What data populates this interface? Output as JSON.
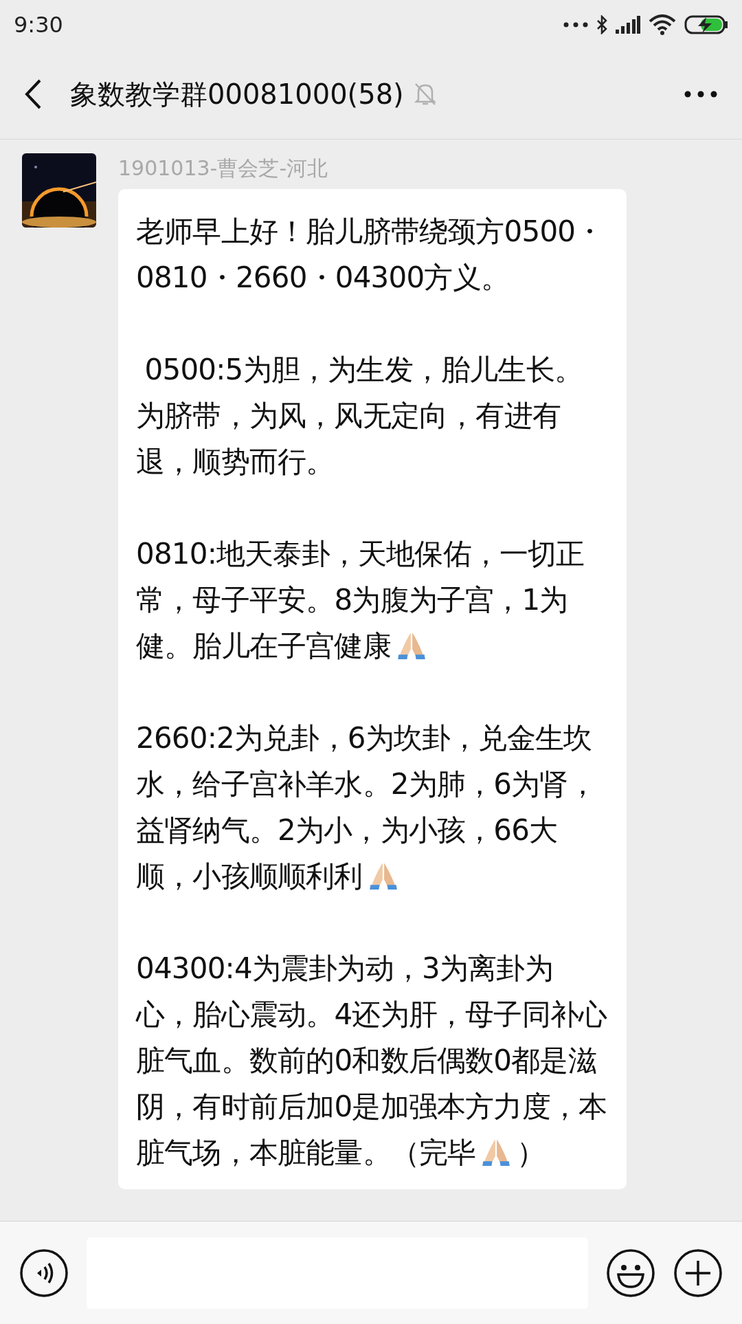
{
  "status_bar": {
    "time": "9:30"
  },
  "header": {
    "title": "象数教学群00081000(58)",
    "muted": true
  },
  "messages": [
    {
      "sender": "1901013-曹会芝-河北",
      "paragraphs": [
        [
          {
            "kind": "text",
            "text": "老师早上好！胎儿脐带绕颈方0500・0810・2660・04300方义。"
          }
        ],
        [
          {
            "kind": "text",
            "text": " 0500:5为胆，为生发，胎儿生长。为脐带，为风，风无定向，有进有退，顺势而行。"
          }
        ],
        [
          {
            "kind": "text",
            "text": "0810:地天泰卦，天地保佑，一切正常，母子平安。8为腹为子宫，1为健。胎儿在子宫健康"
          },
          {
            "kind": "praying-hands"
          }
        ],
        [
          {
            "kind": "text",
            "text": "2660:2为兑卦，6为坎卦，兑金生坎水，给子宫补羊水。2为肺，6为肾，益肾纳气。2为小，为小孩，66大顺，小孩顺顺利利"
          },
          {
            "kind": "praying-hands"
          }
        ],
        [
          {
            "kind": "text",
            "text": "04300:4为震卦为动，3为离卦为心，胎心震动。4还为肝，母子同补心脏气血。数前的0和数后偶数0都是滋阴，有时前后加0是加强本方力度，本脏气场，本脏能量。（完毕"
          },
          {
            "kind": "praying-hands"
          },
          {
            "kind": "text",
            "text": "）"
          }
        ]
      ]
    }
  ]
}
